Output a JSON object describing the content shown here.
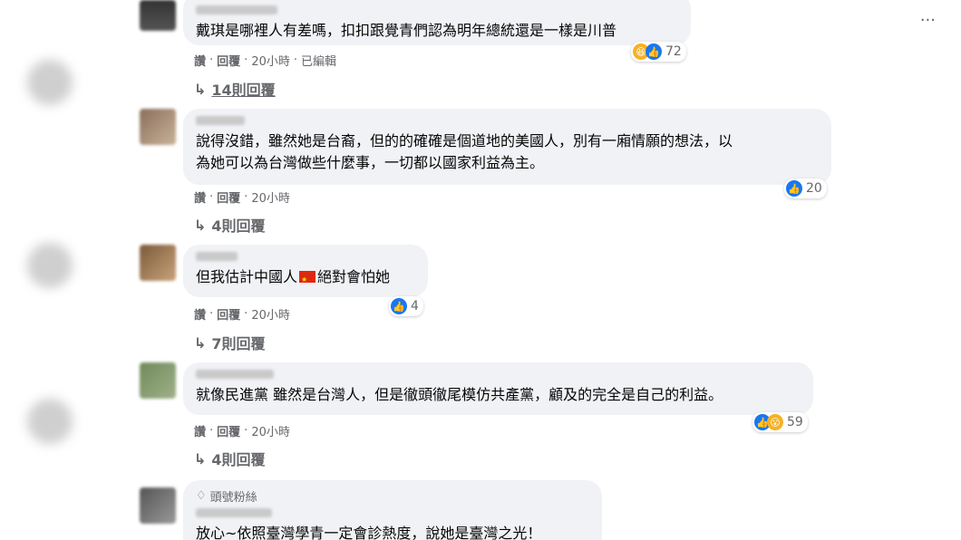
{
  "comments": [
    {
      "text": "戴琪是哪裡人有差嗎，扣扣跟覺青們認為明年總統還是一樣是川普",
      "actions": [
        "讚",
        "回覆",
        "20小時",
        "已編輯"
      ],
      "reaction_count": "72",
      "replies": "14則回覆"
    },
    {
      "text": "說得沒錯，雖然她是台裔，但的的確確是個道地的美國人，別有一廂情願的想法，以\n為她可以為台灣做些什麼事，一切都以國家利益為主。",
      "actions": [
        "讚",
        "回覆",
        "20小時"
      ],
      "reaction_count": "20",
      "replies": "4則回覆"
    },
    {
      "text_before": "但我估計中國人",
      "text_after": "絕對會怕她",
      "actions": [
        "讚",
        "回覆",
        "20小時"
      ],
      "reaction_count": "4",
      "replies": "7則回覆"
    },
    {
      "text": "就像民進黨 雖然是台灣人，但是徹頭徹尾模仿共產黨，顧及的完全是自己的利益。",
      "actions": [
        "讚",
        "回覆",
        "20小時"
      ],
      "reaction_count": "59",
      "replies": "4則回覆"
    },
    {
      "badge": "頭號粉絲",
      "text": "放心~依照臺灣學青一定會診熱度，說她是臺灣之光！"
    }
  ],
  "icons": {
    "more": "more-options-icon",
    "reply_arrow": "reply-arrow-icon",
    "like": "like-icon",
    "haha": "haha-icon",
    "badge": "diamond-icon",
    "flag": "china-flag-emoji"
  },
  "colors": {
    "bubble": "#f0f2f5",
    "like": "#1877f2",
    "meta_text": "#65676b"
  }
}
